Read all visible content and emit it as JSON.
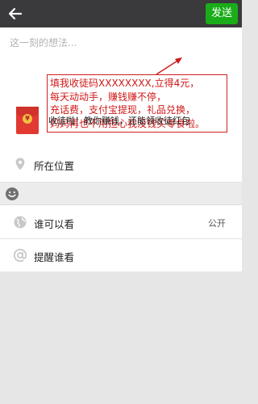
{
  "header": {
    "back_icon": "back-arrow-icon",
    "send_label": "发送"
  },
  "compose": {
    "placeholder": "这一刻的想法..."
  },
  "promo": {
    "lines": [
      "填我收徒码XXXXXXXX,立得4元，",
      "每天动动手，赚钱赚不停，",
      "充话费，支付宝提现，礼品兑换，",
      "妈妈再也不用担心我没钱买零食啦。"
    ]
  },
  "share_card": {
    "coin_glyph": "¥",
    "text": "收徒啦！教你赚钱，还能领收徒红包"
  },
  "options": {
    "location_label": "所在位置",
    "visibility_label": "谁可以看",
    "visibility_value": "公开",
    "remind_label": "提醒谁看"
  },
  "colors": {
    "topbar": "#3a3a3d",
    "send_button": "#1aad19",
    "promo_text": "#d01818",
    "red_packet": "#e23a32"
  }
}
